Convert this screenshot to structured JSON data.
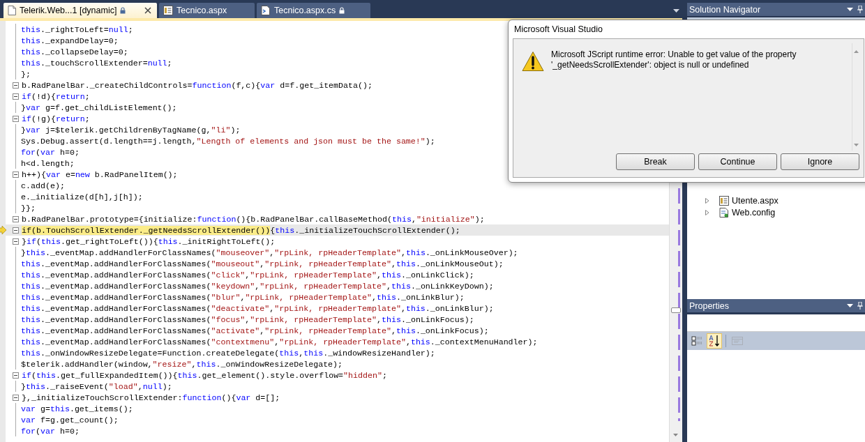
{
  "tabs": [
    {
      "label": "Telerik.Web...1 [dynamic]",
      "kind": "script",
      "locked": true,
      "selected": true,
      "closable": true
    },
    {
      "label": "Tecnico.aspx",
      "kind": "page",
      "locked": false,
      "selected": false,
      "closable": false
    },
    {
      "label": "Tecnico.aspx.cs",
      "kind": "code",
      "locked": true,
      "selected": false,
      "closable": false
    }
  ],
  "editor": {
    "lines": [
      {
        "fold": false,
        "current": false,
        "segs": [
          {
            "kind": "kw",
            "text": "this"
          },
          {
            "kind": "p",
            "text": "._rightToLeft="
          },
          {
            "kind": "kw",
            "text": "null"
          },
          {
            "kind": "p",
            "text": ";"
          }
        ]
      },
      {
        "fold": false,
        "current": false,
        "segs": [
          {
            "kind": "kw",
            "text": "this"
          },
          {
            "kind": "p",
            "text": "._expandDelay=0;"
          }
        ]
      },
      {
        "fold": false,
        "current": false,
        "segs": [
          {
            "kind": "kw",
            "text": "this"
          },
          {
            "kind": "p",
            "text": "._collapseDelay=0;"
          }
        ]
      },
      {
        "fold": false,
        "current": false,
        "segs": [
          {
            "kind": "kw",
            "text": "this"
          },
          {
            "kind": "p",
            "text": "._touchScrollExtender="
          },
          {
            "kind": "kw",
            "text": "null"
          },
          {
            "kind": "p",
            "text": ";"
          }
        ]
      },
      {
        "fold": false,
        "current": false,
        "segs": [
          {
            "kind": "p",
            "text": "};"
          }
        ]
      },
      {
        "fold": true,
        "current": false,
        "segs": [
          {
            "kind": "p",
            "text": "b.RadPanelBar._createChildControls="
          },
          {
            "kind": "kw",
            "text": "function"
          },
          {
            "kind": "p",
            "text": "(f,c){"
          },
          {
            "kind": "kw",
            "text": "var"
          },
          {
            "kind": "p",
            "text": " d=f.get_itemData();"
          }
        ]
      },
      {
        "fold": true,
        "current": false,
        "segs": [
          {
            "kind": "kw",
            "text": "if"
          },
          {
            "kind": "p",
            "text": "(!d){"
          },
          {
            "kind": "kw",
            "text": "return"
          },
          {
            "kind": "p",
            "text": ";"
          }
        ]
      },
      {
        "fold": false,
        "current": false,
        "segs": [
          {
            "kind": "p",
            "text": "}"
          },
          {
            "kind": "kw",
            "text": "var"
          },
          {
            "kind": "p",
            "text": " g=f.get_childListElement();"
          }
        ]
      },
      {
        "fold": true,
        "current": false,
        "segs": [
          {
            "kind": "kw",
            "text": "if"
          },
          {
            "kind": "p",
            "text": "(!g){"
          },
          {
            "kind": "kw",
            "text": "return"
          },
          {
            "kind": "p",
            "text": ";"
          }
        ]
      },
      {
        "fold": false,
        "current": false,
        "segs": [
          {
            "kind": "p",
            "text": "}"
          },
          {
            "kind": "kw",
            "text": "var"
          },
          {
            "kind": "p",
            "text": " j=$telerik.getChildrenByTagName(g,"
          },
          {
            "kind": "str",
            "text": "\"li\""
          },
          {
            "kind": "p",
            "text": ");"
          }
        ]
      },
      {
        "fold": false,
        "current": false,
        "segs": [
          {
            "kind": "p",
            "text": "Sys.Debug.assert(d.length==j.length,"
          },
          {
            "kind": "str",
            "text": "\"Length of elements and json must be the same!\""
          },
          {
            "kind": "p",
            "text": ");"
          }
        ]
      },
      {
        "fold": false,
        "current": false,
        "segs": [
          {
            "kind": "kw",
            "text": "for"
          },
          {
            "kind": "p",
            "text": "("
          },
          {
            "kind": "kw",
            "text": "var"
          },
          {
            "kind": "p",
            "text": " h=0;"
          }
        ]
      },
      {
        "fold": false,
        "current": false,
        "segs": [
          {
            "kind": "p",
            "text": "h<d.length;"
          }
        ]
      },
      {
        "fold": true,
        "current": false,
        "segs": [
          {
            "kind": "p",
            "text": "h++){"
          },
          {
            "kind": "kw",
            "text": "var"
          },
          {
            "kind": "p",
            "text": " e="
          },
          {
            "kind": "kw",
            "text": "new"
          },
          {
            "kind": "p",
            "text": " b.RadPanelItem();"
          }
        ]
      },
      {
        "fold": false,
        "current": false,
        "segs": [
          {
            "kind": "p",
            "text": "c.add(e);"
          }
        ]
      },
      {
        "fold": false,
        "current": false,
        "segs": [
          {
            "kind": "p",
            "text": "e._initialize(d[h],j[h]);"
          }
        ]
      },
      {
        "fold": false,
        "current": false,
        "segs": [
          {
            "kind": "p",
            "text": "}};"
          }
        ]
      },
      {
        "fold": true,
        "current": false,
        "segs": [
          {
            "kind": "p",
            "text": "b.RadPanelBar.prototype={initialize:"
          },
          {
            "kind": "kw",
            "text": "function"
          },
          {
            "kind": "p",
            "text": "(){b.RadPanelBar.callBaseMethod("
          },
          {
            "kind": "kw",
            "text": "this"
          },
          {
            "kind": "p",
            "text": ","
          },
          {
            "kind": "str",
            "text": "\"initialize\""
          },
          {
            "kind": "p",
            "text": ");"
          }
        ]
      },
      {
        "fold": true,
        "current": true,
        "segs": [
          {
            "kind": "hl",
            "text": "if(b.TouchScrollExtender._getNeedsScrollExtender())"
          },
          {
            "kind": "p",
            "text": "{"
          },
          {
            "kind": "kw",
            "text": "this"
          },
          {
            "kind": "p",
            "text": "._initializeTouchScrollExtender();"
          }
        ]
      },
      {
        "fold": true,
        "current": false,
        "segs": [
          {
            "kind": "p",
            "text": "}"
          },
          {
            "kind": "kw",
            "text": "if"
          },
          {
            "kind": "p",
            "text": "("
          },
          {
            "kind": "kw",
            "text": "this"
          },
          {
            "kind": "p",
            "text": ".get_rightToLeft()){"
          },
          {
            "kind": "kw",
            "text": "this"
          },
          {
            "kind": "p",
            "text": "._initRightToLeft();"
          }
        ]
      },
      {
        "fold": false,
        "current": false,
        "segs": [
          {
            "kind": "p",
            "text": "}"
          },
          {
            "kind": "kw",
            "text": "this"
          },
          {
            "kind": "p",
            "text": "._eventMap.addHandlerForClassNames("
          },
          {
            "kind": "str",
            "text": "\"mouseover\""
          },
          {
            "kind": "p",
            "text": ","
          },
          {
            "kind": "str",
            "text": "\"rpLink, rpHeaderTemplate\""
          },
          {
            "kind": "p",
            "text": ","
          },
          {
            "kind": "kw",
            "text": "this"
          },
          {
            "kind": "p",
            "text": "._onLinkMouseOver);"
          }
        ]
      },
      {
        "fold": false,
        "current": false,
        "segs": [
          {
            "kind": "kw",
            "text": "this"
          },
          {
            "kind": "p",
            "text": "._eventMap.addHandlerForClassNames("
          },
          {
            "kind": "str",
            "text": "\"mouseout\""
          },
          {
            "kind": "p",
            "text": ","
          },
          {
            "kind": "str",
            "text": "\"rpLink, rpHeaderTemplate\""
          },
          {
            "kind": "p",
            "text": ","
          },
          {
            "kind": "kw",
            "text": "this"
          },
          {
            "kind": "p",
            "text": "._onLinkMouseOut);"
          }
        ]
      },
      {
        "fold": false,
        "current": false,
        "segs": [
          {
            "kind": "kw",
            "text": "this"
          },
          {
            "kind": "p",
            "text": "._eventMap.addHandlerForClassNames("
          },
          {
            "kind": "str",
            "text": "\"click\""
          },
          {
            "kind": "p",
            "text": ","
          },
          {
            "kind": "str",
            "text": "\"rpLink, rpHeaderTemplate\""
          },
          {
            "kind": "p",
            "text": ","
          },
          {
            "kind": "kw",
            "text": "this"
          },
          {
            "kind": "p",
            "text": "._onLinkClick);"
          }
        ]
      },
      {
        "fold": false,
        "current": false,
        "segs": [
          {
            "kind": "kw",
            "text": "this"
          },
          {
            "kind": "p",
            "text": "._eventMap.addHandlerForClassNames("
          },
          {
            "kind": "str",
            "text": "\"keydown\""
          },
          {
            "kind": "p",
            "text": ","
          },
          {
            "kind": "str",
            "text": "\"rpLink, rpHeaderTemplate\""
          },
          {
            "kind": "p",
            "text": ","
          },
          {
            "kind": "kw",
            "text": "this"
          },
          {
            "kind": "p",
            "text": "._onLinkKeyDown);"
          }
        ]
      },
      {
        "fold": false,
        "current": false,
        "segs": [
          {
            "kind": "kw",
            "text": "this"
          },
          {
            "kind": "p",
            "text": "._eventMap.addHandlerForClassNames("
          },
          {
            "kind": "str",
            "text": "\"blur\""
          },
          {
            "kind": "p",
            "text": ","
          },
          {
            "kind": "str",
            "text": "\"rpLink, rpHeaderTemplate\""
          },
          {
            "kind": "p",
            "text": ","
          },
          {
            "kind": "kw",
            "text": "this"
          },
          {
            "kind": "p",
            "text": "._onLinkBlur);"
          }
        ]
      },
      {
        "fold": false,
        "current": false,
        "segs": [
          {
            "kind": "kw",
            "text": "this"
          },
          {
            "kind": "p",
            "text": "._eventMap.addHandlerForClassNames("
          },
          {
            "kind": "str",
            "text": "\"deactivate\""
          },
          {
            "kind": "p",
            "text": ","
          },
          {
            "kind": "str",
            "text": "\"rpLink, rpHeaderTemplate\""
          },
          {
            "kind": "p",
            "text": ","
          },
          {
            "kind": "kw",
            "text": "this"
          },
          {
            "kind": "p",
            "text": "._onLinkBlur);"
          }
        ]
      },
      {
        "fold": false,
        "current": false,
        "segs": [
          {
            "kind": "kw",
            "text": "this"
          },
          {
            "kind": "p",
            "text": "._eventMap.addHandlerForClassNames("
          },
          {
            "kind": "str",
            "text": "\"focus\""
          },
          {
            "kind": "p",
            "text": ","
          },
          {
            "kind": "str",
            "text": "\"rpLink, rpHeaderTemplate\""
          },
          {
            "kind": "p",
            "text": ","
          },
          {
            "kind": "kw",
            "text": "this"
          },
          {
            "kind": "p",
            "text": "._onLinkFocus);"
          }
        ]
      },
      {
        "fold": false,
        "current": false,
        "segs": [
          {
            "kind": "kw",
            "text": "this"
          },
          {
            "kind": "p",
            "text": "._eventMap.addHandlerForClassNames("
          },
          {
            "kind": "str",
            "text": "\"activate\""
          },
          {
            "kind": "p",
            "text": ","
          },
          {
            "kind": "str",
            "text": "\"rpLink, rpHeaderTemplate\""
          },
          {
            "kind": "p",
            "text": ","
          },
          {
            "kind": "kw",
            "text": "this"
          },
          {
            "kind": "p",
            "text": "._onLinkFocus);"
          }
        ]
      },
      {
        "fold": false,
        "current": false,
        "segs": [
          {
            "kind": "kw",
            "text": "this"
          },
          {
            "kind": "p",
            "text": "._eventMap.addHandlerForClassNames("
          },
          {
            "kind": "str",
            "text": "\"contextmenu\""
          },
          {
            "kind": "p",
            "text": ","
          },
          {
            "kind": "str",
            "text": "\"rpLink, rpHeaderTemplate\""
          },
          {
            "kind": "p",
            "text": ","
          },
          {
            "kind": "kw",
            "text": "this"
          },
          {
            "kind": "p",
            "text": "._contextMenuHandler);"
          }
        ]
      },
      {
        "fold": false,
        "current": false,
        "segs": [
          {
            "kind": "kw",
            "text": "this"
          },
          {
            "kind": "p",
            "text": "._onWindowResizeDelegate=Function.createDelegate("
          },
          {
            "kind": "kw",
            "text": "this"
          },
          {
            "kind": "p",
            "text": ","
          },
          {
            "kind": "kw",
            "text": "this"
          },
          {
            "kind": "p",
            "text": "._windowResizeHandler);"
          }
        ]
      },
      {
        "fold": false,
        "current": false,
        "segs": [
          {
            "kind": "p",
            "text": "$telerik.addHandler(window,"
          },
          {
            "kind": "str",
            "text": "\"resize\""
          },
          {
            "kind": "p",
            "text": ","
          },
          {
            "kind": "kw",
            "text": "this"
          },
          {
            "kind": "p",
            "text": "._onWindowResizeDelegate);"
          }
        ]
      },
      {
        "fold": true,
        "current": false,
        "segs": [
          {
            "kind": "kw",
            "text": "if"
          },
          {
            "kind": "p",
            "text": "("
          },
          {
            "kind": "kw",
            "text": "this"
          },
          {
            "kind": "p",
            "text": ".get_fullExpandedItem()){"
          },
          {
            "kind": "kw",
            "text": "this"
          },
          {
            "kind": "p",
            "text": ".get_element().style.overflow="
          },
          {
            "kind": "str",
            "text": "\"hidden\""
          },
          {
            "kind": "p",
            "text": ";"
          }
        ]
      },
      {
        "fold": false,
        "current": false,
        "segs": [
          {
            "kind": "p",
            "text": "}"
          },
          {
            "kind": "kw",
            "text": "this"
          },
          {
            "kind": "p",
            "text": "._raiseEvent("
          },
          {
            "kind": "str",
            "text": "\"load\""
          },
          {
            "kind": "p",
            "text": ","
          },
          {
            "kind": "kw",
            "text": "null"
          },
          {
            "kind": "p",
            "text": ");"
          }
        ]
      },
      {
        "fold": true,
        "current": false,
        "segs": [
          {
            "kind": "p",
            "text": "},_initializeTouchScrollExtender:"
          },
          {
            "kind": "kw",
            "text": "function"
          },
          {
            "kind": "p",
            "text": "(){"
          },
          {
            "kind": "kw",
            "text": "var"
          },
          {
            "kind": "p",
            "text": " d=[];"
          }
        ]
      },
      {
        "fold": false,
        "current": false,
        "segs": [
          {
            "kind": "kw",
            "text": "var"
          },
          {
            "kind": "p",
            "text": " g="
          },
          {
            "kind": "kw",
            "text": "this"
          },
          {
            "kind": "p",
            "text": ".get_items();"
          }
        ]
      },
      {
        "fold": false,
        "current": false,
        "segs": [
          {
            "kind": "kw",
            "text": "var"
          },
          {
            "kind": "p",
            "text": " f=g.get_count();"
          }
        ]
      },
      {
        "fold": false,
        "current": false,
        "segs": [
          {
            "kind": "kw",
            "text": "for"
          },
          {
            "kind": "p",
            "text": "("
          },
          {
            "kind": "kw",
            "text": "var"
          },
          {
            "kind": "p",
            "text": " h=0;"
          }
        ]
      }
    ]
  },
  "solution_navigator": {
    "title": "Solution Navigator",
    "items": [
      {
        "label": "Utente.aspx",
        "kind": "page",
        "expanded": false
      },
      {
        "label": "Web.config",
        "kind": "config",
        "expanded": false
      }
    ]
  },
  "properties": {
    "title": "Properties",
    "toolbar": [
      {
        "kind": "categorized",
        "selected": false,
        "disabled": false
      },
      {
        "kind": "alphabetical",
        "selected": true,
        "disabled": false
      },
      {
        "kind": "pages",
        "selected": false,
        "disabled": true
      }
    ]
  },
  "dialog": {
    "title": "Microsoft Visual Studio",
    "message": "Microsoft JScript runtime error: Unable to get value of the property '_getNeedsScrollExtender': object is null or undefined",
    "buttons": [
      "Break",
      "Continue",
      "Ignore"
    ]
  }
}
